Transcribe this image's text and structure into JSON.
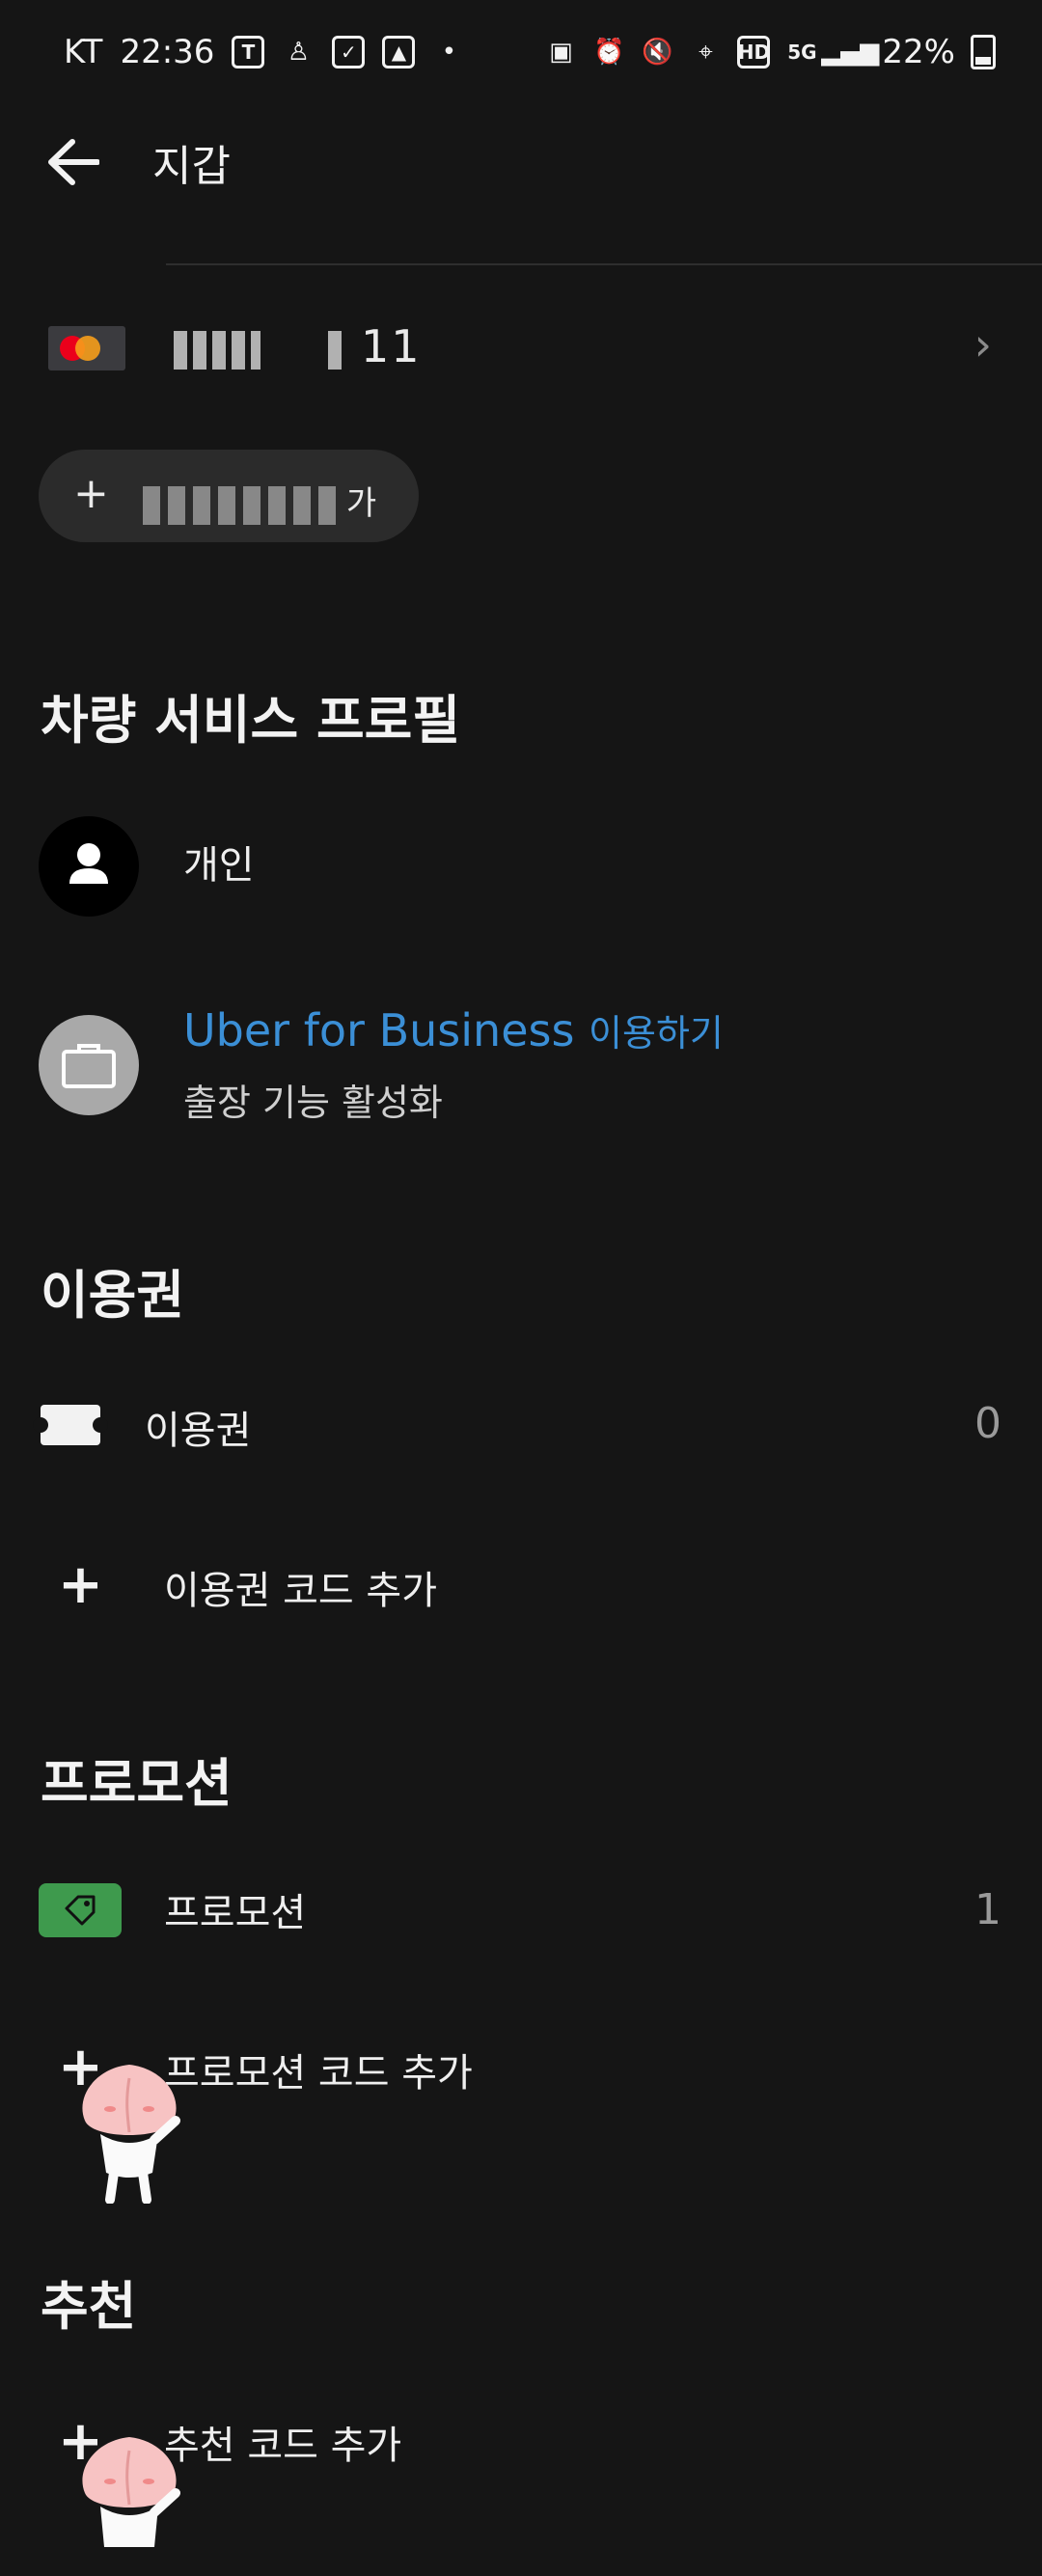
{
  "status_bar": {
    "carrier": "KT",
    "time": "22:36",
    "network": "5G",
    "battery": "22%"
  },
  "header": {
    "title": "지갑"
  },
  "payment": {
    "card_suffix": "11",
    "add_label": "가"
  },
  "profiles": {
    "section_title": "차량 서비스 프로필",
    "personal_label": "개인",
    "business_title_en": "Uber for Business",
    "business_title_ko": "이용하기",
    "business_subtitle": "출장 기능 활성화"
  },
  "vouchers": {
    "section_title": "이용권",
    "item_label": "이용권",
    "item_count": "0",
    "add_label": "이용권 코드 추가"
  },
  "promotions": {
    "section_title": "프로모션",
    "item_label": "프로모션",
    "item_count": "1",
    "add_label": "프로모션 코드 추가"
  },
  "referrals": {
    "section_title": "추천",
    "add_label": "추천 코드 추가"
  },
  "colors": {
    "background": "#151515",
    "business_link": "#3b8fd6",
    "promo_tag": "#3e9a4d"
  }
}
